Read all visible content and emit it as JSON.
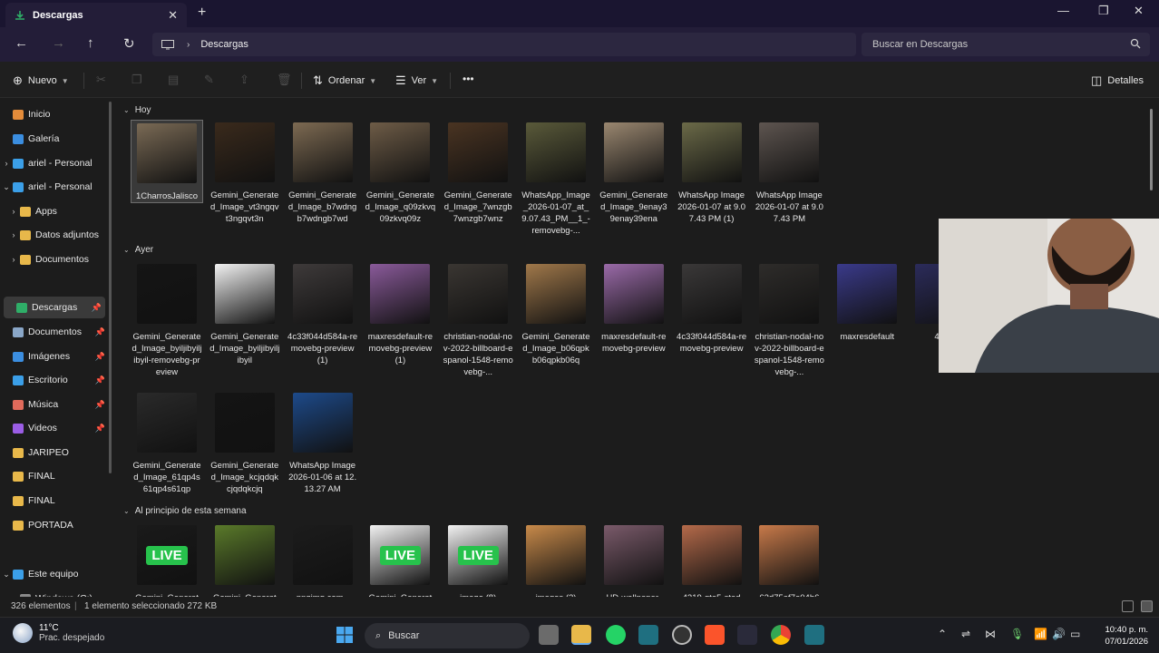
{
  "window": {
    "tab_title": "Descargas",
    "tab_close": "✕",
    "new_tab": "+",
    "minimize": "—",
    "maximize": "❐",
    "close": "✕"
  },
  "address": {
    "path_segment": "Descargas",
    "search_placeholder": "Buscar en Descargas"
  },
  "command": {
    "new_label": "Nuevo",
    "sort_label": "Ordenar",
    "view_label": "Ver",
    "more": "•••",
    "details_label": "Detalles"
  },
  "sidebar": {
    "items": [
      {
        "label": "Inicio",
        "icon": "home-icon",
        "color": "#e48c3a"
      },
      {
        "label": "Galería",
        "icon": "gallery-icon",
        "color": "#3b8ee0"
      },
      {
        "label": "ariel - Personal",
        "icon": "cloud-icon",
        "color": "#3b9fe8"
      },
      {
        "label": "ariel - Personal",
        "icon": "cloud-icon",
        "color": "#3b9fe8"
      },
      {
        "label": "Apps",
        "icon": "folder-icon",
        "color": "#e8b84a"
      },
      {
        "label": "Datos adjuntos",
        "icon": "folder-icon",
        "color": "#e8b84a"
      },
      {
        "label": "Documentos",
        "icon": "folder-icon",
        "color": "#e8b84a"
      },
      {
        "label": "Descargas",
        "icon": "download-icon",
        "color": "#2fae68"
      },
      {
        "label": "Documentos",
        "icon": "document-icon",
        "color": "#8aa7c8"
      },
      {
        "label": "Imágenes",
        "icon": "pictures-icon",
        "color": "#3b8ee0"
      },
      {
        "label": "Escritorio",
        "icon": "desktop-icon",
        "color": "#3b9fe8"
      },
      {
        "label": "Música",
        "icon": "music-icon",
        "color": "#e06a5b"
      },
      {
        "label": "Videos",
        "icon": "videos-icon",
        "color": "#9b5de5"
      },
      {
        "label": "JARIPEO",
        "icon": "folder-icon",
        "color": "#e8b84a"
      },
      {
        "label": "FINAL",
        "icon": "folder-icon",
        "color": "#e8b84a"
      },
      {
        "label": "FINAL",
        "icon": "folder-icon",
        "color": "#e8b84a"
      },
      {
        "label": "PORTADA",
        "icon": "folder-icon",
        "color": "#e8b84a"
      },
      {
        "label": "Este equipo",
        "icon": "computer-icon",
        "color": "#3b9fe8"
      },
      {
        "label": "Windows (C:)",
        "icon": "drive-icon",
        "color": "#8a8a8a"
      }
    ]
  },
  "groups": {
    "today": "Hoy",
    "yesterday": "Ayer",
    "this_week": "Al principio de esta semana"
  },
  "files": {
    "today": [
      {
        "name": "1CharrosJalisco",
        "color": "#7a6a55"
      },
      {
        "name": "Gemini_Generated_Image_vt3ngqvt3ngqvt3n",
        "color": "#3a2a1c"
      },
      {
        "name": "Gemini_Generated_Image_b7wdngb7wdngb7wd",
        "color": "#7d6a52"
      },
      {
        "name": "Gemini_Generated_Image_q09zkvq09zkvq09z",
        "color": "#6e5c47"
      },
      {
        "name": "Gemini_Generated_Image_7wnzgb7wnzgb7wnz",
        "color": "#4a3422"
      },
      {
        "name": "WhatsApp_Image_2026-01-07_at_9.07.43_PM__1_-removebg-...",
        "color": "#5a5a3a"
      },
      {
        "name": "Gemini_Generated_Image_9enay39enay39ena",
        "color": "#9a8770"
      },
      {
        "name": "WhatsApp Image 2026-01-07 at 9.07.43 PM (1)",
        "color": "#6b6a48"
      },
      {
        "name": "WhatsApp Image 2026-01-07 at 9.07.43 PM",
        "color": "#5e5550"
      }
    ],
    "yesterday": [
      {
        "name": "Gemini_Generated_Image_byiljibyiljibyil-removebg-preview",
        "color": "#151515"
      },
      {
        "name": "Gemini_Generated_Image_byiljibyiljibyil",
        "color": "#f2f2f2"
      },
      {
        "name": "4c33f044d584a-removebg-preview (1)",
        "color": "#3e3a3a"
      },
      {
        "name": "maxresdefault-removebg-preview (1)",
        "color": "#8a5a9a"
      },
      {
        "name": "christian-nodal-nov-2022-billboard-espanol-1548-removebg-...",
        "color": "#3a3632"
      },
      {
        "name": "Gemini_Generated_Image_b06qpkb06qpkb06q",
        "color": "#a0784a"
      },
      {
        "name": "maxresdefault-removebg-preview",
        "color": "#9a6aa8"
      },
      {
        "name": "4c33f044d584a-removebg-preview",
        "color": "#3a3838"
      },
      {
        "name": "christian-nodal-nov-2022-billboard-espanol-1548-removebg-...",
        "color": "#2e2c2a"
      },
      {
        "name": "maxresdefault",
        "color": "#3a3a8a"
      },
      {
        "name": "4c33f",
        "color": "#2b2b5a"
      }
    ],
    "yesterday2": [
      {
        "name": "Gemini_Generated_Image_61qp4s61qp4s61qp",
        "color": "#2a2a2a"
      },
      {
        "name": "Gemini_Generated_Image_kcjqdqkcjqdqkcjq",
        "color": "#141414"
      },
      {
        "name": "WhatsApp Image 2026-01-06 at 12.13.27 AM",
        "color": "#1d4a8a"
      }
    ],
    "this_week": [
      {
        "name": "Gemini_Generat",
        "color": "#1a1a1a",
        "badge": "LIVE"
      },
      {
        "name": "Gemini_Generat",
        "color": "#5a7a2a"
      },
      {
        "name": "pngimg.com -",
        "color": "#1c1c1c"
      },
      {
        "name": "Gemini_Generat",
        "color": "#f2f2f2",
        "badge": "LIVE"
      },
      {
        "name": "image (8)",
        "color": "#f2f2f2",
        "badge": "LIVE"
      },
      {
        "name": "images (2)",
        "color": "#c88a4a"
      },
      {
        "name": "HD-wallpaper-",
        "color": "#7a5a6a"
      },
      {
        "name": "4219-gta5-stad",
        "color": "#b46a4a"
      },
      {
        "name": "62d75af7e04b6",
        "color": "#c87a4a"
      }
    ]
  },
  "status": {
    "count": "326 elementos",
    "selection": "1 elemento seleccionado  272 KB"
  },
  "taskbar": {
    "temp": "11°C",
    "condition": "Prac. despejado",
    "search": "Buscar",
    "time": "10:40 p. m.",
    "date": "07/01/2026"
  }
}
